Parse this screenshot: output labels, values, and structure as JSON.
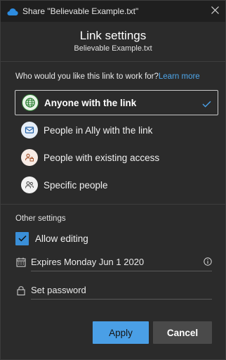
{
  "window": {
    "title": "Share \"Believable Example.txt\"",
    "app_icon": "onedrive-cloud-icon",
    "close_icon": "close-icon"
  },
  "header": {
    "title": "Link settings",
    "filename": "Believable Example.txt"
  },
  "question": {
    "text": "Who would you like this link to work for?",
    "link": "Learn more"
  },
  "options": [
    {
      "label": "Anyone with the link",
      "icon": "globe-icon",
      "selected": true
    },
    {
      "label": "People in Ally with the link",
      "icon": "building-icon",
      "selected": false
    },
    {
      "label": "People with existing access",
      "icon": "people-lock-icon",
      "selected": false
    },
    {
      "label": "Specific people",
      "icon": "people-icon",
      "selected": false
    }
  ],
  "other": {
    "label": "Other settings",
    "allow_editing": {
      "label": "Allow editing",
      "checked": true
    },
    "expires": {
      "value": "Expires Monday Jun 1 2020",
      "icon": "calendar-icon",
      "info_icon": "info-icon"
    },
    "password": {
      "placeholder": "Set password",
      "icon": "lock-icon"
    }
  },
  "actions": {
    "apply": "Apply",
    "cancel": "Cancel"
  },
  "colors": {
    "accent": "#4a9fe6",
    "link": "#4ea6ea",
    "background": "#2b2b2b"
  }
}
